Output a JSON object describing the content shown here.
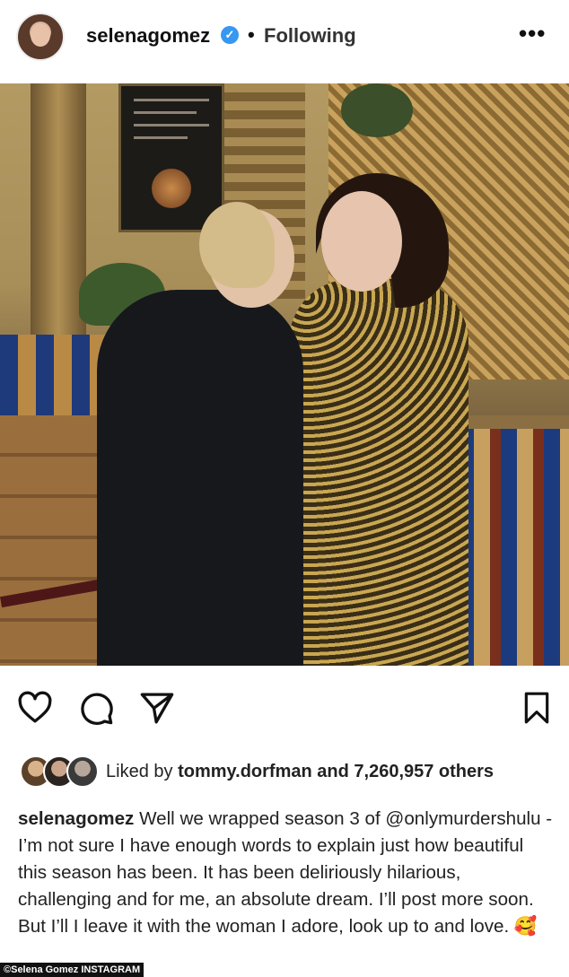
{
  "header": {
    "username": "selenagomez",
    "verified_symbol": "✓",
    "separator": "•",
    "follow_status": "Following",
    "more_label": "•••"
  },
  "post_image": {
    "alt": "Two women posing in an ornate golden lobby"
  },
  "icons": {
    "like": "heart-icon",
    "comment": "comment-icon",
    "share": "paper-plane-icon",
    "save": "bookmark-icon"
  },
  "likes": {
    "prefix": "Liked by",
    "user": "tommy.dorfman",
    "connector": "and",
    "count": "7,260,957 others"
  },
  "caption": {
    "username": "selenagomez",
    "text": "Well we wrapped season 3 of @onlymurdershulu -I’m not sure I have enough words to explain just how beautiful this season has been. It has been deliriously hilarious, challenging and for me, an absolute dream. I’ll post more soon. But I’ll I leave it with the woman I adore, look up to and love. 🥰"
  },
  "credit": "©Selena Gomez INSTAGRAM",
  "colors": {
    "verified": "#3897f0",
    "text": "#222222",
    "background": "#ffffff"
  }
}
